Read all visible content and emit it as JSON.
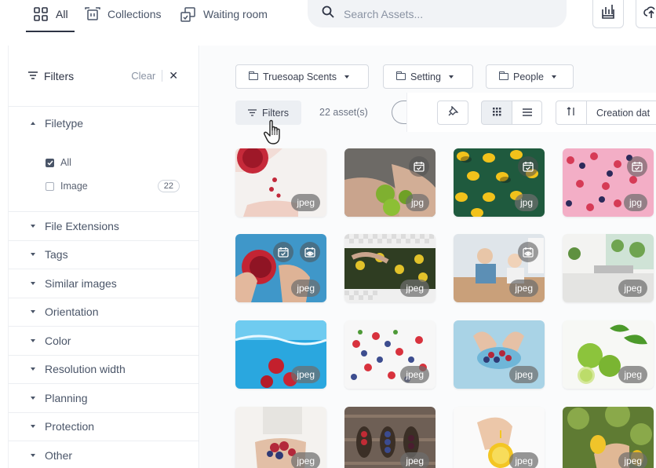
{
  "topbar": {
    "tabs": [
      {
        "label": "All",
        "icon": "grid-icon"
      },
      {
        "label": "Collections",
        "icon": "collections-icon"
      },
      {
        "label": "Waiting room",
        "icon": "waiting-room-icon"
      }
    ],
    "search_placeholder": "Search Assets..."
  },
  "sidebar": {
    "title": "Filters",
    "clear_label": "Clear",
    "close_glyph": "✕",
    "filetype": {
      "label": "Filetype",
      "options": [
        {
          "label": "All",
          "checked": true
        },
        {
          "label": "Image",
          "checked": false,
          "count": "22"
        }
      ]
    },
    "sections": [
      "File Extensions",
      "Tags",
      "Similar images",
      "Orientation",
      "Color",
      "Resolution width",
      "Planning",
      "Protection",
      "Other"
    ]
  },
  "main": {
    "folders": [
      "Truesoap Scents",
      "Setting",
      "People"
    ],
    "filters_label": "Filters",
    "asset_count": "22 asset(s)",
    "sort_label": "Creation dat",
    "assets": [
      {
        "ext": "jpeg",
        "theme": "pomegranate",
        "icons": []
      },
      {
        "ext": "jpg",
        "theme": "limes-hands",
        "icons": [
          "schedule-icon"
        ]
      },
      {
        "ext": "jpg",
        "theme": "lemons-green",
        "icons": [
          "schedule-icon"
        ]
      },
      {
        "ext": "jpg",
        "theme": "berries-pink",
        "icons": [
          "schedule-icon"
        ]
      },
      {
        "ext": "jpeg",
        "theme": "pomegranate-blue",
        "icons": [
          "schedule-icon",
          "view-icon"
        ]
      },
      {
        "ext": "jpeg",
        "theme": "lemon-tree",
        "icons": []
      },
      {
        "ext": "jpeg",
        "theme": "kitchen-family",
        "icons": [
          "view-icon"
        ]
      },
      {
        "ext": "jpeg",
        "theme": "kitchen-white",
        "icons": []
      },
      {
        "ext": "jpeg",
        "theme": "water-splash",
        "icons": []
      },
      {
        "ext": "jpeg",
        "theme": "berries-white",
        "icons": []
      },
      {
        "ext": "jpeg",
        "theme": "berries-bowl",
        "icons": []
      },
      {
        "ext": "jpeg",
        "theme": "limes-white",
        "icons": []
      },
      {
        "ext": "jpeg",
        "theme": "berries-hands",
        "icons": []
      },
      {
        "ext": "jpeg",
        "theme": "spoons-berries",
        "icons": []
      },
      {
        "ext": "jpeg",
        "theme": "lemon-squeeze",
        "icons": []
      },
      {
        "ext": "jpeg",
        "theme": "lemon-picking",
        "icons": []
      }
    ]
  }
}
